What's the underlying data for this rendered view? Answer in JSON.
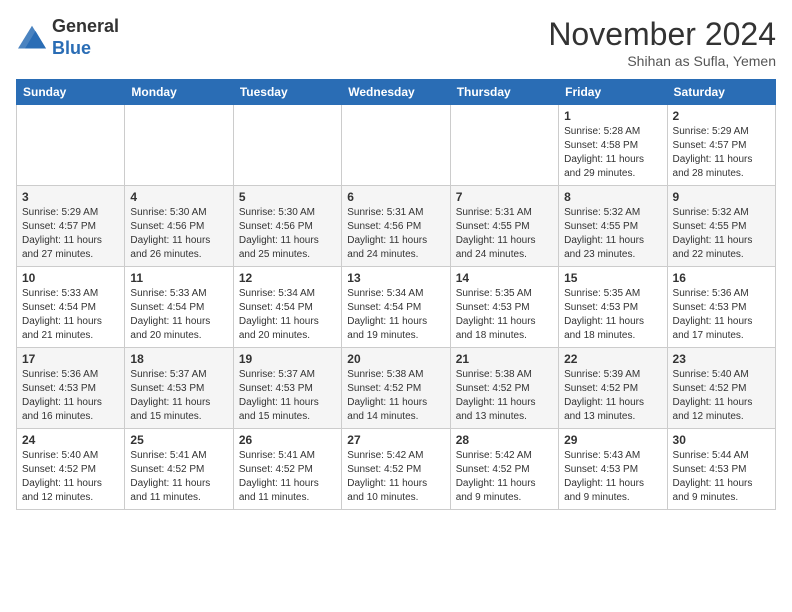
{
  "logo": {
    "general": "General",
    "blue": "Blue"
  },
  "header": {
    "month": "November 2024",
    "location": "Shihan as Sufla, Yemen"
  },
  "weekdays": [
    "Sunday",
    "Monday",
    "Tuesday",
    "Wednesday",
    "Thursday",
    "Friday",
    "Saturday"
  ],
  "weeks": [
    [
      {
        "day": "",
        "info": ""
      },
      {
        "day": "",
        "info": ""
      },
      {
        "day": "",
        "info": ""
      },
      {
        "day": "",
        "info": ""
      },
      {
        "day": "",
        "info": ""
      },
      {
        "day": "1",
        "info": "Sunrise: 5:28 AM\nSunset: 4:58 PM\nDaylight: 11 hours\nand 29 minutes."
      },
      {
        "day": "2",
        "info": "Sunrise: 5:29 AM\nSunset: 4:57 PM\nDaylight: 11 hours\nand 28 minutes."
      }
    ],
    [
      {
        "day": "3",
        "info": "Sunrise: 5:29 AM\nSunset: 4:57 PM\nDaylight: 11 hours\nand 27 minutes."
      },
      {
        "day": "4",
        "info": "Sunrise: 5:30 AM\nSunset: 4:56 PM\nDaylight: 11 hours\nand 26 minutes."
      },
      {
        "day": "5",
        "info": "Sunrise: 5:30 AM\nSunset: 4:56 PM\nDaylight: 11 hours\nand 25 minutes."
      },
      {
        "day": "6",
        "info": "Sunrise: 5:31 AM\nSunset: 4:56 PM\nDaylight: 11 hours\nand 24 minutes."
      },
      {
        "day": "7",
        "info": "Sunrise: 5:31 AM\nSunset: 4:55 PM\nDaylight: 11 hours\nand 24 minutes."
      },
      {
        "day": "8",
        "info": "Sunrise: 5:32 AM\nSunset: 4:55 PM\nDaylight: 11 hours\nand 23 minutes."
      },
      {
        "day": "9",
        "info": "Sunrise: 5:32 AM\nSunset: 4:55 PM\nDaylight: 11 hours\nand 22 minutes."
      }
    ],
    [
      {
        "day": "10",
        "info": "Sunrise: 5:33 AM\nSunset: 4:54 PM\nDaylight: 11 hours\nand 21 minutes."
      },
      {
        "day": "11",
        "info": "Sunrise: 5:33 AM\nSunset: 4:54 PM\nDaylight: 11 hours\nand 20 minutes."
      },
      {
        "day": "12",
        "info": "Sunrise: 5:34 AM\nSunset: 4:54 PM\nDaylight: 11 hours\nand 20 minutes."
      },
      {
        "day": "13",
        "info": "Sunrise: 5:34 AM\nSunset: 4:54 PM\nDaylight: 11 hours\nand 19 minutes."
      },
      {
        "day": "14",
        "info": "Sunrise: 5:35 AM\nSunset: 4:53 PM\nDaylight: 11 hours\nand 18 minutes."
      },
      {
        "day": "15",
        "info": "Sunrise: 5:35 AM\nSunset: 4:53 PM\nDaylight: 11 hours\nand 18 minutes."
      },
      {
        "day": "16",
        "info": "Sunrise: 5:36 AM\nSunset: 4:53 PM\nDaylight: 11 hours\nand 17 minutes."
      }
    ],
    [
      {
        "day": "17",
        "info": "Sunrise: 5:36 AM\nSunset: 4:53 PM\nDaylight: 11 hours\nand 16 minutes."
      },
      {
        "day": "18",
        "info": "Sunrise: 5:37 AM\nSunset: 4:53 PM\nDaylight: 11 hours\nand 15 minutes."
      },
      {
        "day": "19",
        "info": "Sunrise: 5:37 AM\nSunset: 4:53 PM\nDaylight: 11 hours\nand 15 minutes."
      },
      {
        "day": "20",
        "info": "Sunrise: 5:38 AM\nSunset: 4:52 PM\nDaylight: 11 hours\nand 14 minutes."
      },
      {
        "day": "21",
        "info": "Sunrise: 5:38 AM\nSunset: 4:52 PM\nDaylight: 11 hours\nand 13 minutes."
      },
      {
        "day": "22",
        "info": "Sunrise: 5:39 AM\nSunset: 4:52 PM\nDaylight: 11 hours\nand 13 minutes."
      },
      {
        "day": "23",
        "info": "Sunrise: 5:40 AM\nSunset: 4:52 PM\nDaylight: 11 hours\nand 12 minutes."
      }
    ],
    [
      {
        "day": "24",
        "info": "Sunrise: 5:40 AM\nSunset: 4:52 PM\nDaylight: 11 hours\nand 12 minutes."
      },
      {
        "day": "25",
        "info": "Sunrise: 5:41 AM\nSunset: 4:52 PM\nDaylight: 11 hours\nand 11 minutes."
      },
      {
        "day": "26",
        "info": "Sunrise: 5:41 AM\nSunset: 4:52 PM\nDaylight: 11 hours\nand 11 minutes."
      },
      {
        "day": "27",
        "info": "Sunrise: 5:42 AM\nSunset: 4:52 PM\nDaylight: 11 hours\nand 10 minutes."
      },
      {
        "day": "28",
        "info": "Sunrise: 5:42 AM\nSunset: 4:52 PM\nDaylight: 11 hours\nand 9 minutes."
      },
      {
        "day": "29",
        "info": "Sunrise: 5:43 AM\nSunset: 4:53 PM\nDaylight: 11 hours\nand 9 minutes."
      },
      {
        "day": "30",
        "info": "Sunrise: 5:44 AM\nSunset: 4:53 PM\nDaylight: 11 hours\nand 9 minutes."
      }
    ]
  ]
}
